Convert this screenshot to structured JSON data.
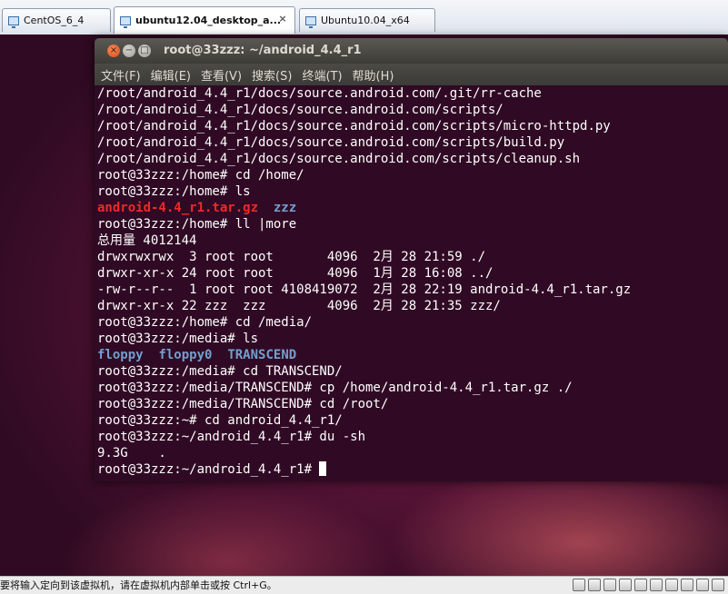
{
  "host": {
    "tabs": [
      {
        "label": "CentOS_6_4"
      },
      {
        "label": "ubuntu12.04_desktop_a..."
      },
      {
        "label": "Ubuntu10.04_x64"
      }
    ],
    "tab_close_glyph": "×",
    "status": {
      "message": "要将输入定向到该虚拟机，请在虚拟机内部单击或按 Ctrl+G。",
      "icons": [
        "hdd-icon",
        "network-icon",
        "cdrom-icon",
        "printer-icon",
        "sound-icon",
        "floppy-icon",
        "floppy-icon",
        "display-icon",
        "usb-icon",
        "message-icon"
      ]
    }
  },
  "terminal": {
    "title": "root@33zzz: ~/android_4.4_r1",
    "buttons": {
      "close": "×",
      "minimize": "−",
      "maximize": "□"
    },
    "menu": [
      "文件(F)",
      "编辑(E)",
      "查看(V)",
      "搜索(S)",
      "终端(T)",
      "帮助(H)"
    ],
    "lines": [
      "/root/android_4.4_r1/docs/source.android.com/.git/rr-cache",
      "/root/android_4.4_r1/docs/source.android.com/scripts/",
      "/root/android_4.4_r1/docs/source.android.com/scripts/micro-httpd.py",
      "/root/android_4.4_r1/docs/source.android.com/scripts/build.py",
      "/root/android_4.4_r1/docs/source.android.com/scripts/cleanup.sh",
      "root@33zzz:/home# cd /home/",
      "root@33zzz:/home# ls",
      {
        "parts": [
          {
            "text": "android-4.4_r1.tar.gz",
            "color": "red"
          },
          {
            "text": "  "
          },
          {
            "text": "zzz",
            "color": "blue"
          }
        ]
      },
      "root@33zzz:/home# ll |more",
      "总用量 4012144",
      "drwxrwxrwx  3 root root       4096  2月 28 21:59 ./",
      "drwxr-xr-x 24 root root       4096  1月 28 16:08 ../",
      "-rw-r--r--  1 root root 4108419072  2月 28 22:19 android-4.4_r1.tar.gz",
      "drwxr-xr-x 22 zzz  zzz        4096  2月 28 21:35 zzz/",
      "root@33zzz:/home# cd /media/",
      "root@33zzz:/media# ls",
      {
        "parts": [
          {
            "text": "floppy",
            "color": "blue"
          },
          {
            "text": "  "
          },
          {
            "text": "floppy0",
            "color": "blue"
          },
          {
            "text": "  "
          },
          {
            "text": "TRANSCEND",
            "color": "blue"
          }
        ]
      },
      "root@33zzz:/media# cd TRANSCEND/",
      "root@33zzz:/media/TRANSCEND# cp /home/android-4.4_r1.tar.gz ./",
      "root@33zzz:/media/TRANSCEND# cd /root/",
      "root@33zzz:~# cd android_4.4_r1/",
      "root@33zzz:~/android_4.4_r1# du -sh",
      "9.3G    .",
      {
        "parts": [
          {
            "text": "root@33zzz:~/android_4.4_r1# "
          }
        ],
        "cursor": true
      }
    ]
  }
}
